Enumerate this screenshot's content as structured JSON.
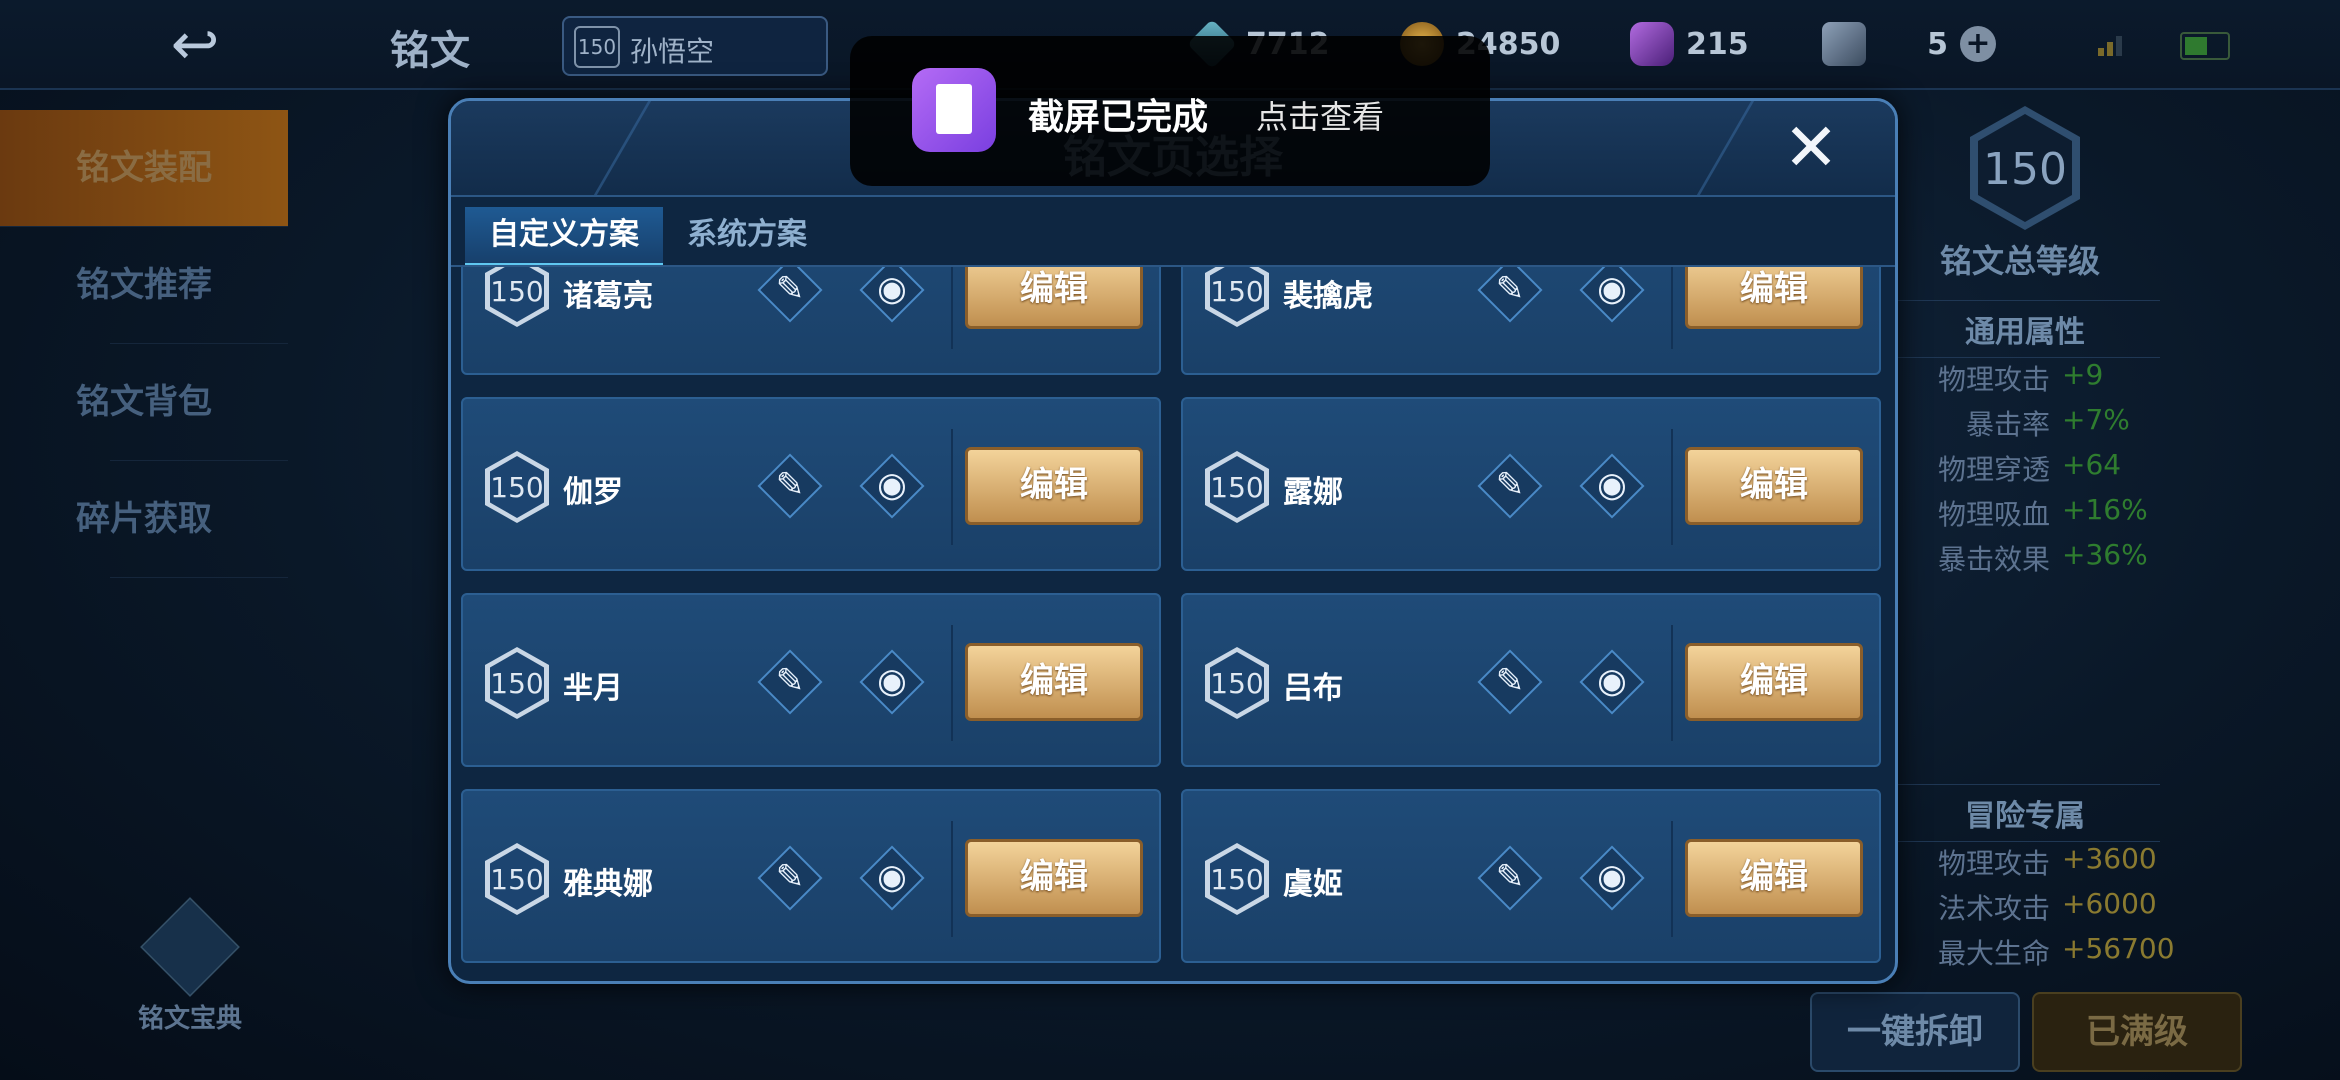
{
  "topbar": {
    "back_icon": "back-arrow-icon",
    "title": "铭文",
    "hero_level": "150",
    "hero_name": "孙悟空",
    "resources": [
      {
        "icon": "crystal-icon",
        "value": "7712"
      },
      {
        "icon": "gold-coin-icon",
        "value": "24850"
      },
      {
        "icon": "gem-icon",
        "value": "215"
      },
      {
        "icon": "card-icon",
        "value": "5"
      }
    ]
  },
  "leftnav": {
    "items": [
      {
        "label": "铭文装配",
        "active": true
      },
      {
        "label": "铭文推荐",
        "active": false
      },
      {
        "label": "铭文背包",
        "active": false
      },
      {
        "label": "碎片获取",
        "active": false
      }
    ],
    "codex_label": "铭文宝典"
  },
  "rightpanel": {
    "total_level": "150",
    "total_label": "铭文总等级",
    "general_title": "通用属性",
    "general_stats": [
      {
        "k": "物理攻击",
        "v": "+9"
      },
      {
        "k": "暴击率",
        "v": "+7%"
      },
      {
        "k": "物理穿透",
        "v": "+64"
      },
      {
        "k": "物理吸血",
        "v": "+16%"
      },
      {
        "k": "暴击效果",
        "v": "+36%"
      }
    ],
    "adventure_title": "冒险专属",
    "adventure_stats": [
      {
        "k": "物理攻击",
        "v": "+3600"
      },
      {
        "k": "法术攻击",
        "v": "+6000"
      },
      {
        "k": "最大生命",
        "v": "+56700"
      }
    ],
    "btn_disassemble": "一键拆卸",
    "btn_maxed": "已满级"
  },
  "modal": {
    "title": "铭文页选择",
    "tabs": [
      "自定义方案",
      "系统方案"
    ],
    "edit_label": "编辑",
    "pages": [
      {
        "level": "150",
        "name": "诸葛亮"
      },
      {
        "level": "150",
        "name": "裴擒虎"
      },
      {
        "level": "150",
        "name": "伽罗"
      },
      {
        "level": "150",
        "name": "露娜"
      },
      {
        "level": "150",
        "name": "芈月"
      },
      {
        "level": "150",
        "name": "吕布"
      },
      {
        "level": "150",
        "name": "雅典娜"
      },
      {
        "level": "150",
        "name": "虞姬"
      }
    ]
  },
  "toast": {
    "message": "截屏已完成",
    "link": "点击查看"
  }
}
